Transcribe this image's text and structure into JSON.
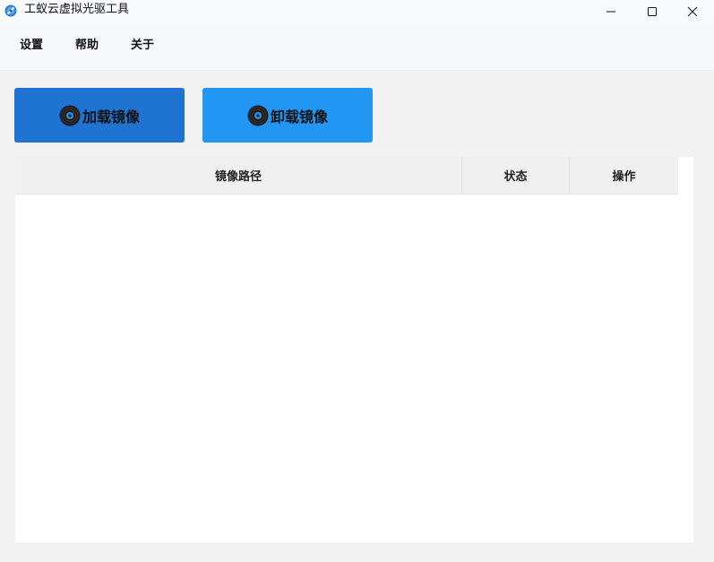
{
  "window": {
    "title": "工蚁云虚拟光驱工具",
    "app_icon": "disc-app-icon",
    "controls": {
      "minimize": "minimize-icon",
      "maximize": "maximize-icon",
      "close": "close-icon"
    }
  },
  "menu": {
    "items": [
      {
        "label": "设置"
      },
      {
        "label": "帮助"
      },
      {
        "label": "关于"
      }
    ]
  },
  "toolbar": {
    "load_label": "加载镜像",
    "unload_label": "卸载镜像",
    "load_color": "#1f73d1",
    "unload_color": "#2196f3",
    "icon": "disc-icon"
  },
  "table": {
    "columns": [
      "镜像路径",
      "状态",
      "操作"
    ],
    "rows": []
  }
}
